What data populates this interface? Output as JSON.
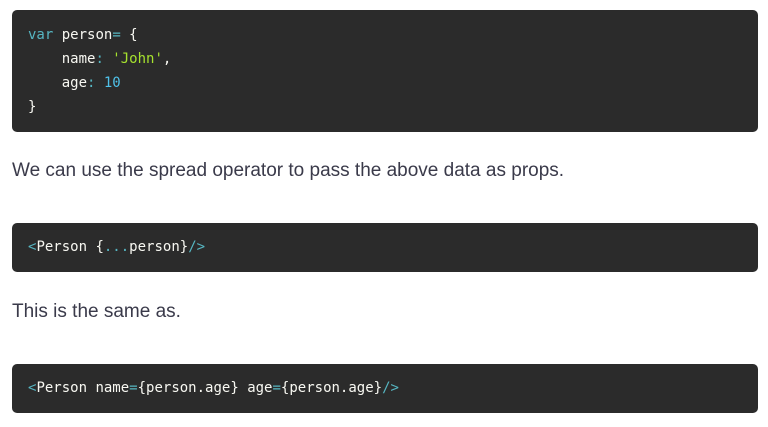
{
  "code_block_1": {
    "line1": {
      "keyword": "var",
      "name": " person",
      "op": "=",
      "brace": " {"
    },
    "line2": {
      "indent": "    ",
      "key": "name",
      "op": ":",
      "value": " 'John'",
      "comma": ","
    },
    "line3": {
      "indent": "    ",
      "key": "age",
      "op": ":",
      "value": " 10"
    },
    "line4": {
      "brace": "}"
    }
  },
  "paragraph_1": "We can use the spread operator to pass the above data as props.",
  "code_block_2": {
    "open": "<",
    "tag": "Person",
    "space": " {",
    "spread": "...",
    "obj": "person}",
    "close": "/>"
  },
  "paragraph_2": "This is the same as.",
  "code_block_3": {
    "open": "<",
    "tag": "Person",
    "attr1": " name",
    "eq1": "=",
    "val1": "{person.age}",
    "attr2": " age",
    "eq2": "=",
    "val2": "{person.age}",
    "close": "/>"
  },
  "colors": {
    "code_background": "#2b2b2b",
    "keyword": "#56b6c2",
    "string": "#a6e22e",
    "number": "#4fc1e9",
    "text": "#3a3a4a"
  }
}
